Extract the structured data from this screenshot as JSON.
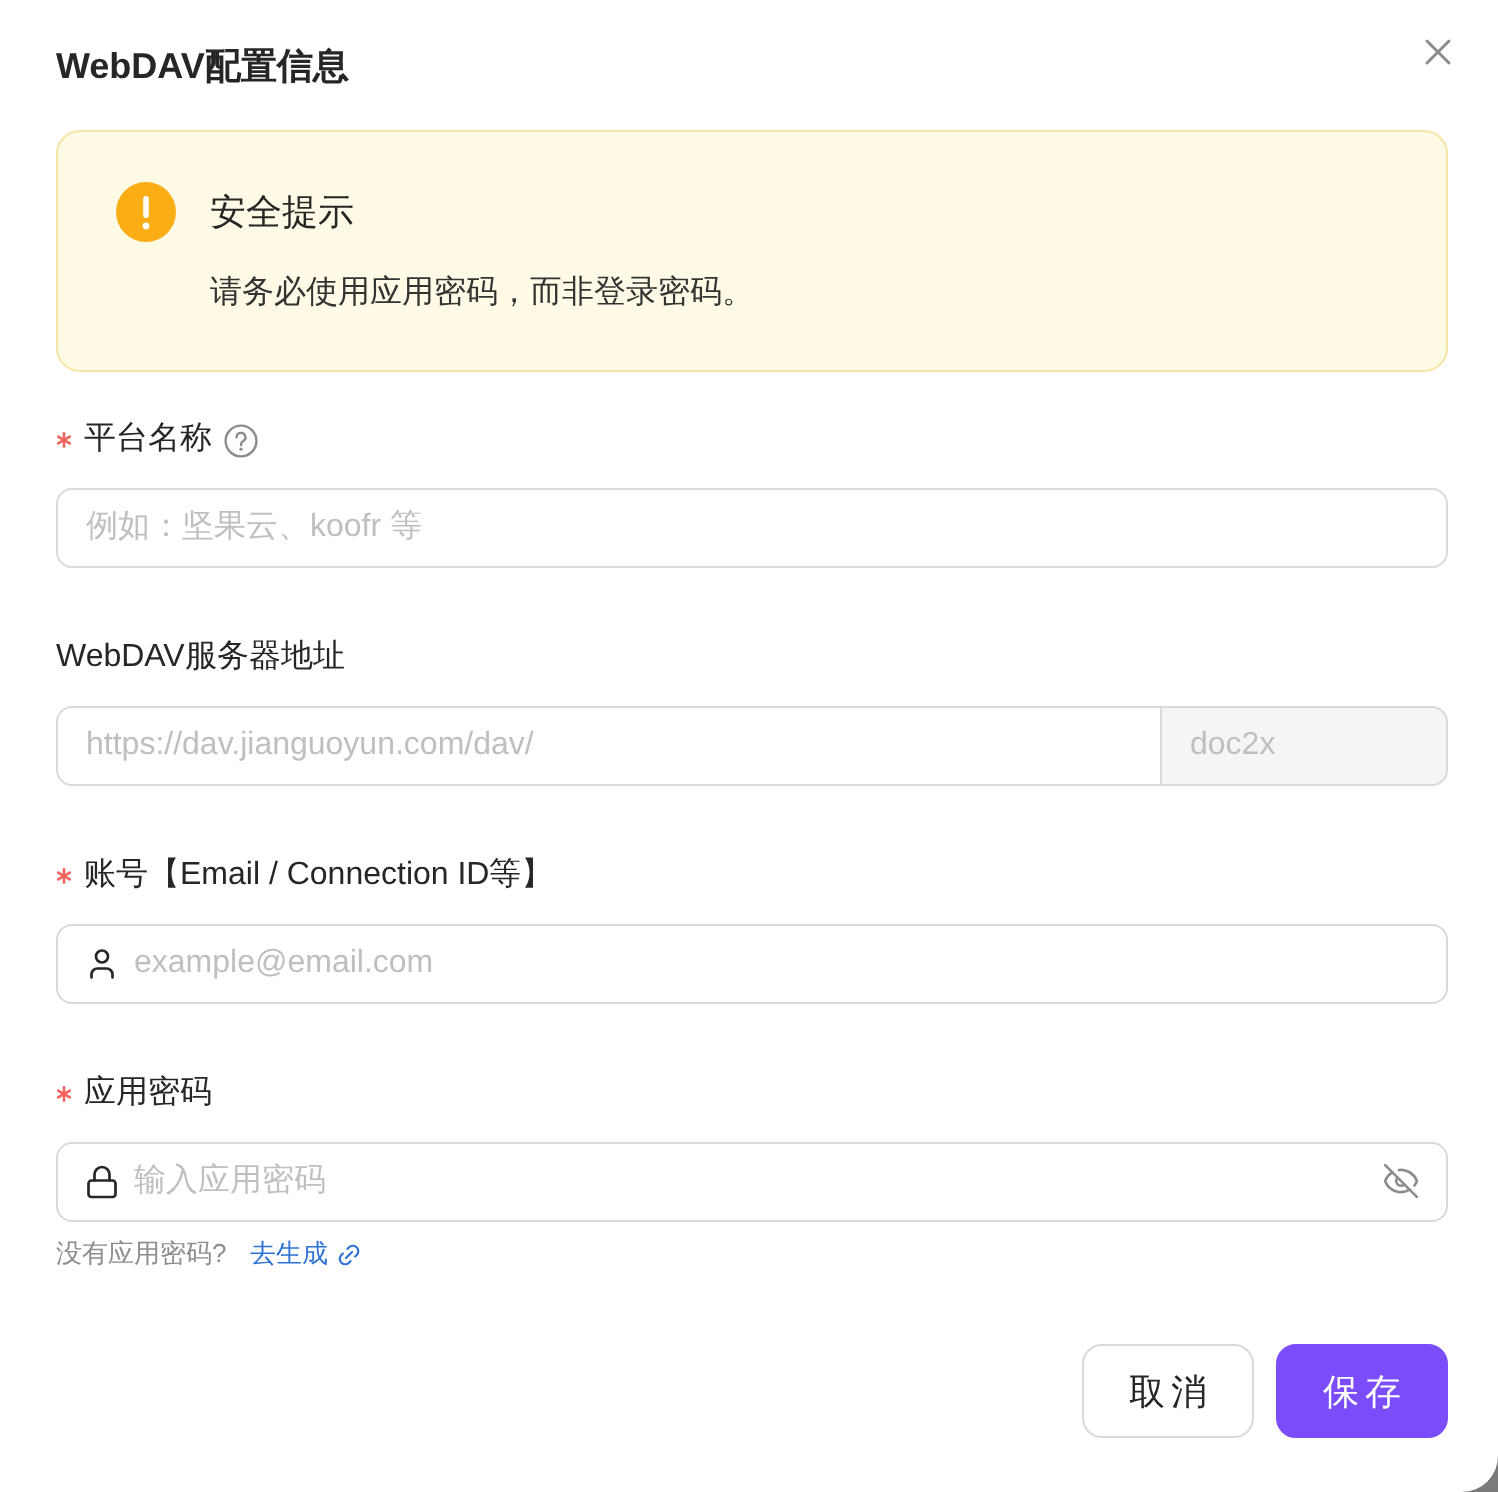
{
  "dialog": {
    "title": "WebDAV配置信息"
  },
  "alert": {
    "kind": "warning",
    "title": "安全提示",
    "message": "请务必使用应用密码，而非登录密码。"
  },
  "fields": [
    {
      "kind": "text",
      "label": "平台名称",
      "required": true,
      "help": true,
      "placeholder": "例如：坚果云、koofr 等"
    },
    {
      "kind": "url",
      "label": "WebDAV服务器地址",
      "placeholder": "https://dav.jianguoyun.com/dav/",
      "suffix": "doc2x"
    },
    {
      "kind": "account",
      "label": "账号【Email / Connection ID等】",
      "required": true,
      "placeholder": "example@email.com"
    },
    {
      "kind": "password",
      "label": "应用密码",
      "required": true,
      "placeholder": "输入应用密码",
      "hint": "没有应用密码?",
      "hint_link": "去生成"
    }
  ],
  "buttons": [
    {
      "label": "取消",
      "kind": "secondary"
    },
    {
      "label": "保存",
      "kind": "primary"
    }
  ]
}
